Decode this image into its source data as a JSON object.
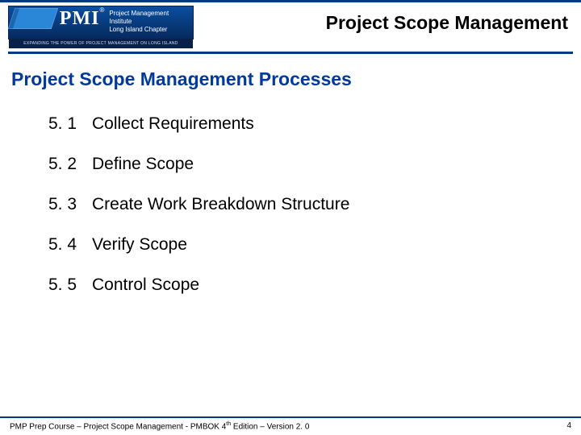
{
  "header": {
    "logo": {
      "abbr": "PMI",
      "reg": "®",
      "line1": "Project Management Institute",
      "line2": "Long Island Chapter",
      "tagline": "EXPANDING THE POWER OF PROJECT MANAGEMENT ON LONG ISLAND"
    },
    "title": "Project Scope Management"
  },
  "subtitle": "Project Scope Management Processes",
  "items": [
    {
      "num": "5. 1",
      "text": "Collect Requirements"
    },
    {
      "num": "5. 2",
      "text": "Define Scope"
    },
    {
      "num": "5. 3",
      "text": "Create Work Breakdown Structure"
    },
    {
      "num": "5. 4",
      "text": "Verify Scope"
    },
    {
      "num": "5. 5",
      "text": "Control Scope"
    }
  ],
  "footer": {
    "left_a": "PMP Prep Course – Project Scope Management - PMBOK 4",
    "left_sup": "th",
    "left_b": " Edition – Version 2. 0",
    "page": "4"
  }
}
